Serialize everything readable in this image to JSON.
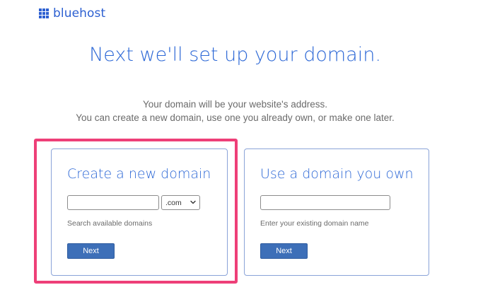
{
  "brand": {
    "name": "bluehost",
    "color": "#2d60d1",
    "icon": "grid-logo-icon"
  },
  "headline": "Next we'll set up your domain.",
  "subtext": {
    "line1": "Your domain will be your website's address.",
    "line2": "You can create a new domain, use one you already own, or make one later."
  },
  "cards": {
    "create": {
      "title": "Create a new domain",
      "input_value": "",
      "tld_selected": ".com",
      "hint": "Search available domains",
      "button_label": "Next",
      "highlighted": true
    },
    "existing": {
      "title": "Use a domain you own",
      "input_value": "",
      "hint": "Enter your existing domain name",
      "button_label": "Next"
    }
  },
  "colors": {
    "accent": "#2d68d6",
    "button": "#3d6fb8",
    "highlight": "#ee3f78"
  }
}
